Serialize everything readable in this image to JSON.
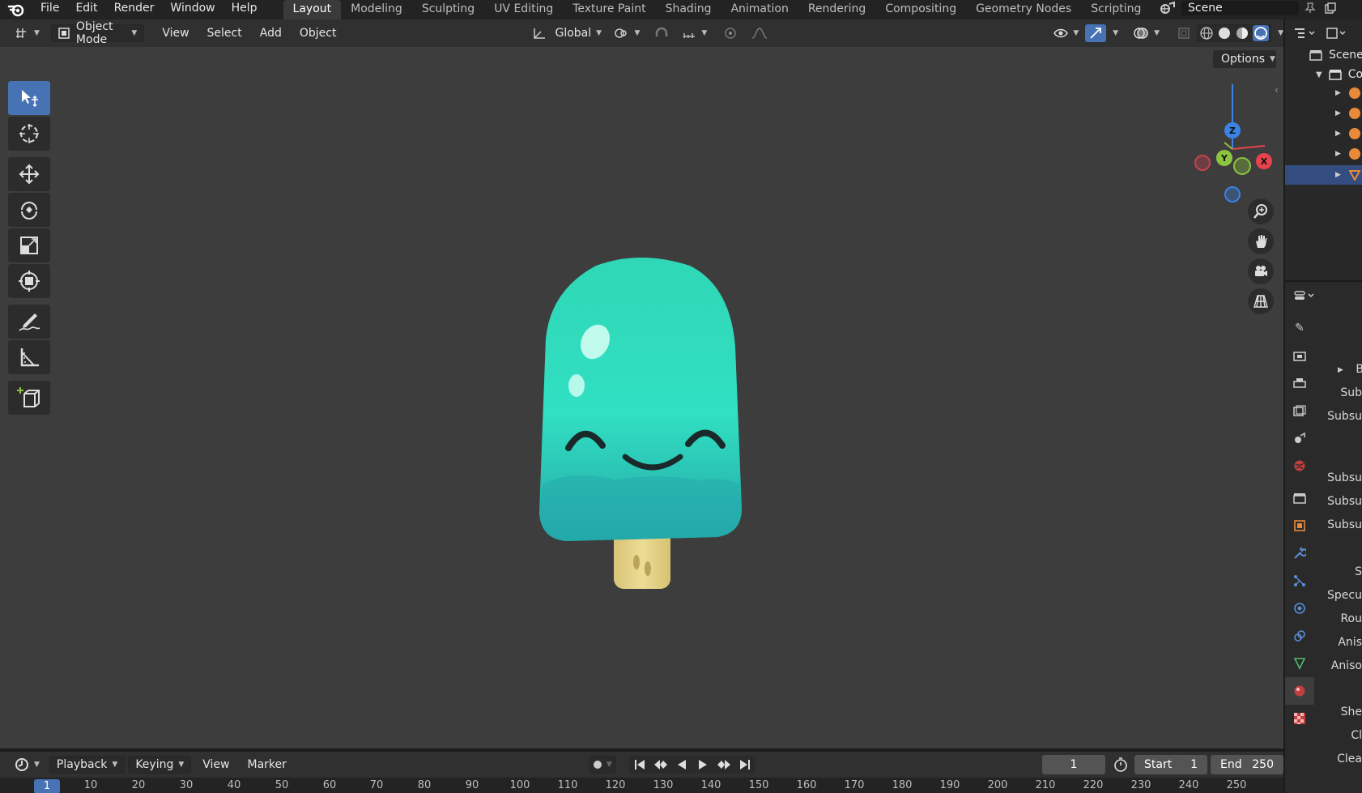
{
  "topbar": {
    "menus": [
      "File",
      "Edit",
      "Render",
      "Window",
      "Help"
    ],
    "workspaces": [
      "Layout",
      "Modeling",
      "Sculpting",
      "UV Editing",
      "Texture Paint",
      "Shading",
      "Animation",
      "Rendering",
      "Compositing",
      "Geometry Nodes",
      "Scripting"
    ],
    "active_workspace": "Layout",
    "add_symbol": "+",
    "scene_name": "Scene"
  },
  "viewport_header": {
    "mode": "Object Mode",
    "menus": [
      "View",
      "Select",
      "Add",
      "Object"
    ],
    "orientation": "Global",
    "options_label": "Options"
  },
  "gizmo": {
    "x": "X",
    "y": "Y",
    "z": "Z"
  },
  "outliner": {
    "scene_label": "Scene",
    "collection_label": "Co"
  },
  "properties": {
    "labels": [
      "B",
      "Sub",
      "Subsu",
      "Subsu",
      "Subsu",
      "Subsu",
      "S",
      "Specu",
      "Rou",
      "Anis",
      "Aniso",
      "She",
      "Cl",
      "Clea"
    ]
  },
  "timeline": {
    "menus": [
      "Playback",
      "Keying",
      "View",
      "Marker"
    ],
    "current_frame": "1",
    "start_label": "Start",
    "start_value": "1",
    "end_label": "End",
    "end_value": "250",
    "ruler_current": "1",
    "ruler_ticks": [
      "10",
      "20",
      "30",
      "40",
      "50",
      "60",
      "70",
      "80",
      "90",
      "100",
      "110",
      "120",
      "130",
      "140",
      "150",
      "160",
      "170",
      "180",
      "190",
      "200",
      "210",
      "220",
      "230",
      "240",
      "250"
    ]
  },
  "colors": {
    "accent": "#4772b3",
    "popsicle_top": "#2ee0c0",
    "popsicle_bottom": "#25b3b0",
    "stick": "#e7d58a",
    "axis_x": "#e8424f",
    "axis_y": "#8bc43f",
    "axis_z": "#3b83e4"
  }
}
